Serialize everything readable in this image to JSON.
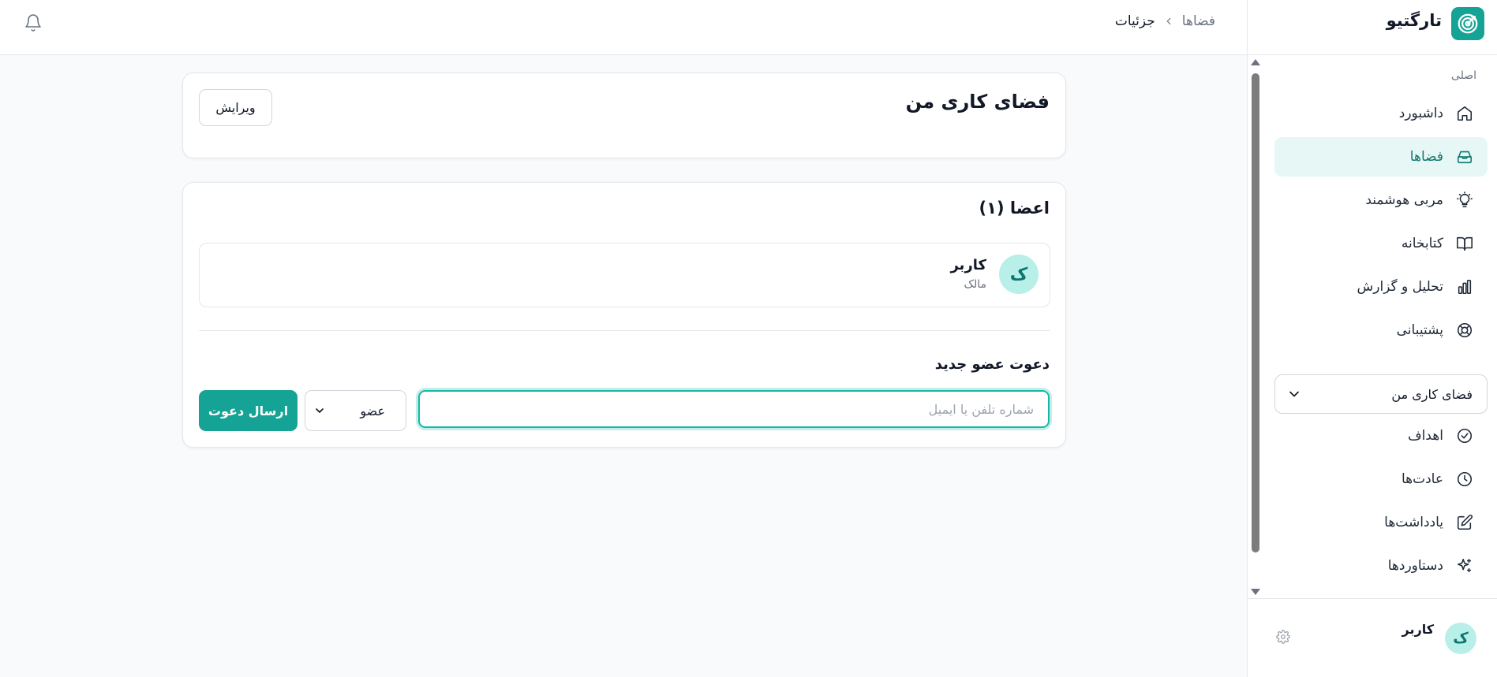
{
  "app": {
    "brand_name": "تارگتیو",
    "accent_color": "#14a394",
    "active_bg_color": "#e6f7f5"
  },
  "header": {
    "breadcrumb": {
      "parent": "فضاها",
      "current": "جزئیات"
    },
    "bell_icon": "bell-icon"
  },
  "sidebar": {
    "section_label": "اصلی",
    "items": [
      {
        "label": "داشبورد",
        "icon": "home-icon"
      },
      {
        "label": "فضاها",
        "icon": "inbox-icon",
        "active": true
      },
      {
        "label": "مربی هوشمند",
        "icon": "lightbulb-icon"
      },
      {
        "label": "کتابخانه",
        "icon": "book-icon"
      },
      {
        "label": "تحلیل و گزارش",
        "icon": "bar-chart-icon"
      },
      {
        "label": "پشتیبانی",
        "icon": "lifebuoy-icon"
      }
    ],
    "workspace_select": "فضای کاری من",
    "workspace_items": [
      {
        "label": "اهداف",
        "icon": "check-circle-icon"
      },
      {
        "label": "عادت‌ها",
        "icon": "clock-icon"
      },
      {
        "label": "یادداشت‌ها",
        "icon": "edit-icon"
      },
      {
        "label": "دستاوردها",
        "icon": "sparkles-icon"
      }
    ],
    "user": {
      "initial": "ک",
      "name": "کاربر",
      "settings_icon": "gear-icon"
    }
  },
  "workspace_card": {
    "title": "فضای کاری من",
    "edit_label": "ویرایش"
  },
  "members_card": {
    "title": "اعضا (۱)",
    "members": [
      {
        "initial": "ک",
        "name": "کاربر",
        "role": "مالک"
      }
    ],
    "invite": {
      "title": "دعوت عضو جدید",
      "placeholder": "شماره تلفن یا ایمیل",
      "role_value": "عضو",
      "send_label": "ارسال دعوت"
    }
  }
}
